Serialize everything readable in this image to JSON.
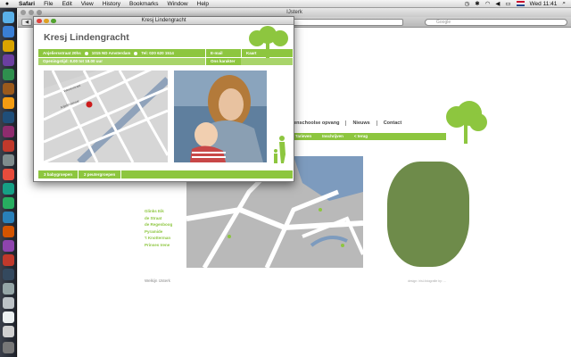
{
  "menubar": {
    "app": "Safari",
    "items": [
      "File",
      "Edit",
      "View",
      "History",
      "Bookmarks",
      "Window",
      "Help"
    ],
    "clock": "Wed 11:41"
  },
  "browser": {
    "title": "IJsterk",
    "search_placeholder": "Google"
  },
  "background_site": {
    "heading": "ER",
    "nav": [
      "buitenschoolse opvang",
      "Nieuws",
      "Contact"
    ],
    "subnav": [
      "Tarieven",
      "Inschrijven",
      "< terug"
    ],
    "list": [
      "Glinks Eik",
      "de Straat",
      "de Regenboog",
      "Pyramide",
      "'t Knotterman",
      "Prinses Irene"
    ],
    "footer": "Welkijn IJsterk",
    "credit": "design: irisl-fotografie by: ..."
  },
  "popup": {
    "window_title": "Kresj Lindengracht",
    "name": "Kresj Lindengracht",
    "address": "Anjeliersstraat 20hs",
    "postcode": "1015 ND Amsterdam",
    "phone": "Tel: 020 620 1514",
    "email_link": "E-mail",
    "map_link": "Kaart",
    "opening": "Openingstijd: 8.00 tot 18.00 uur",
    "character_link": "Ons karakter",
    "map_street_1": "Westerstraat",
    "map_street_2": "Anjeliersstraat",
    "tabs": [
      "3 babygroepen",
      "2 peutergroepen"
    ]
  },
  "colors": {
    "accent_green": "#8dc63f",
    "light_green": "#a8d46a",
    "map_grey": "#b9b9b9",
    "water_blue": "#7d9bbe"
  }
}
